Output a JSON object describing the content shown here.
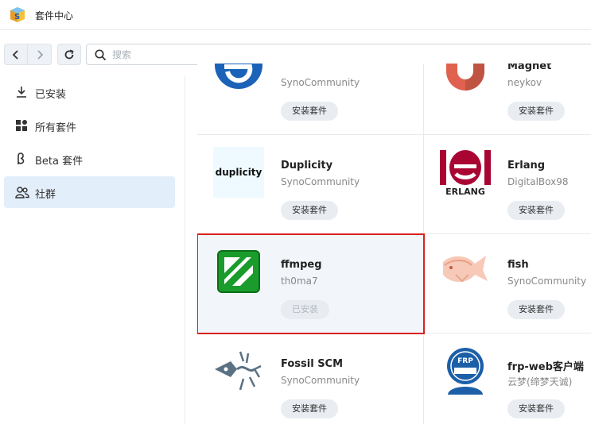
{
  "window": {
    "title": "套件中心"
  },
  "toolbar": {
    "search_placeholder": "搜索"
  },
  "sidebar": {
    "items": [
      {
        "label": "已安装",
        "icon": "download-icon",
        "active": false
      },
      {
        "label": "所有套件",
        "icon": "grid-icon",
        "active": false
      },
      {
        "label": "Beta 套件",
        "icon": "beta-icon",
        "active": false
      },
      {
        "label": "社群",
        "icon": "community-icon",
        "active": true
      }
    ]
  },
  "packages": [
    {
      "name": "",
      "author": "SynoCommunity",
      "button": "安装套件",
      "logo": "blue-circle-logo"
    },
    {
      "name": "Magnet",
      "author": "neykov",
      "button": "安装套件",
      "logo": "magnet-logo"
    },
    {
      "name": "Duplicity",
      "author": "SynoCommunity",
      "button": "安装套件",
      "logo": "duplicity-logo",
      "logo_text": "duplicity"
    },
    {
      "name": "Erlang",
      "author": "DigitalBox98",
      "button": "安装套件",
      "logo": "erlang-logo",
      "logo_text": "ERLANG"
    },
    {
      "name": "ffmpeg",
      "author": "th0ma7",
      "button": "已安装",
      "logo": "ffmpeg-logo",
      "installed": true,
      "selected": true
    },
    {
      "name": "fish",
      "author": "SynoCommunity",
      "button": "安装套件",
      "logo": "fish-logo"
    },
    {
      "name": "Fossil SCM",
      "author": "SynoCommunity",
      "button": "安装套件",
      "logo": "fossil-logo"
    },
    {
      "name": "frp-web客户端",
      "author": "云梦(缔梦天诚)",
      "button": "安装套件",
      "logo": "frp-logo",
      "logo_text": "FRP"
    }
  ],
  "colors": {
    "accent": "#1f6fd6",
    "selection": "#d9201f",
    "sidebar_active": "#e3eefb"
  }
}
